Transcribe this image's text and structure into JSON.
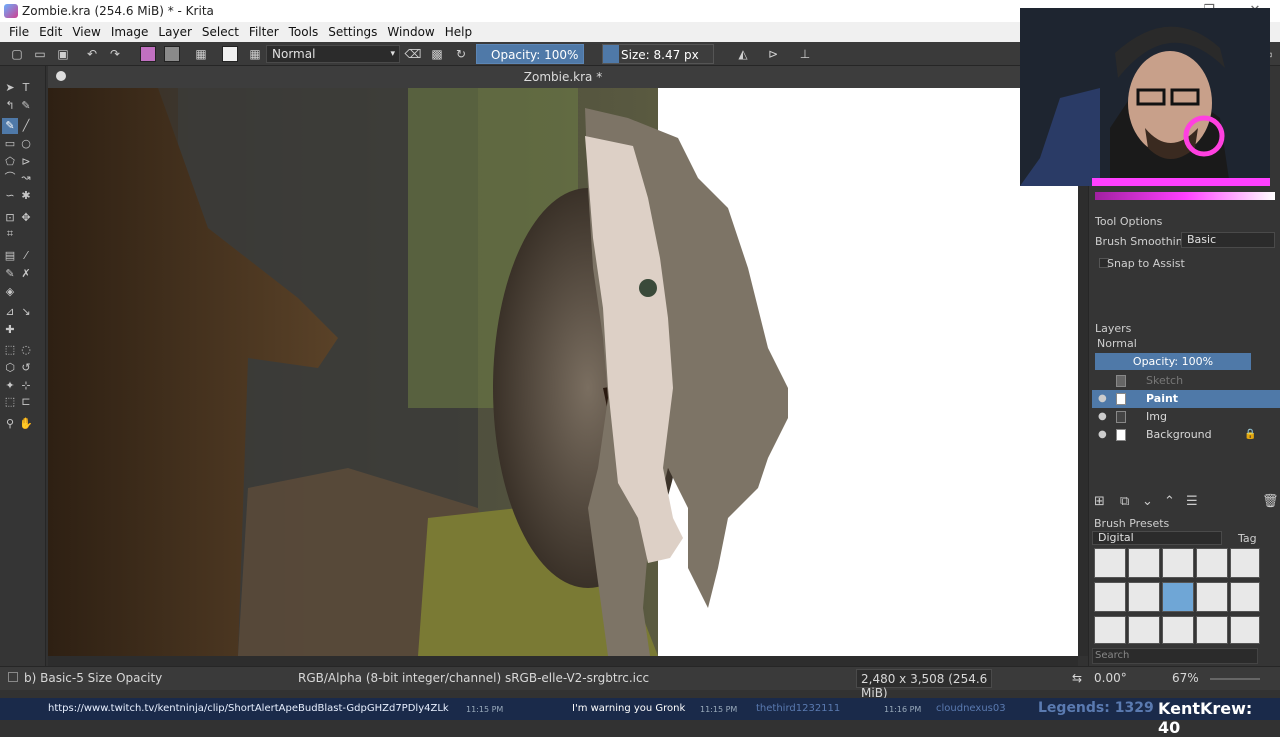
{
  "window": {
    "title": "Zombie.kra (254.6 MiB)  * - Krita",
    "minimize": "—",
    "maximize": "❐",
    "close": "✕"
  },
  "menu": [
    "File",
    "Edit",
    "View",
    "Image",
    "Layer",
    "Select",
    "Filter",
    "Tools",
    "Settings",
    "Window",
    "Help"
  ],
  "toolbar": {
    "blend_mode": "Normal",
    "opacity_label": "Opacity: 100%",
    "size_label": "Size: 8.47 px",
    "fg_color": "#c070c0",
    "bg_color": "#8a8a8a"
  },
  "document": {
    "tab_title": "Zombie.kra *"
  },
  "docker": {
    "tool_options_title": "Tool Options",
    "brush_smoothing_label": "Brush Smoothing",
    "brush_smoothing_value": "Basic",
    "snap_label": "Snap to Assist",
    "layers_title": "Layers",
    "layers_blend": "Normal",
    "layers_opacity": "Opacity:  100%",
    "layers": [
      {
        "name": "Sketch",
        "visible": false,
        "locked": false
      },
      {
        "name": "Paint",
        "visible": true,
        "locked": false,
        "active": true
      },
      {
        "name": "Img",
        "visible": true,
        "locked": false
      },
      {
        "name": "Background",
        "visible": true,
        "locked": true
      }
    ],
    "brush_presets_title": "Brush Presets",
    "preset_tag": "Digital",
    "tag_label": "Tag",
    "search_placeholder": "Search"
  },
  "statusbar": {
    "brush": "b) Basic-5 Size Opacity",
    "color_profile": "RGB/Alpha (8-bit integer/channel)  sRGB-elle-V2-srgbtrc.icc",
    "dimensions": "2,480 x 3,508 (254.6 MiB)",
    "rotation": "0.00°",
    "zoom": "67%"
  },
  "streambar": {
    "clip_url": "https://www.twitch.tv/kentninja/clip/ShortAlertApeBudBlast-GdpGHZd7PDly4ZLk",
    "time1": "11:15 PM",
    "message": "I'm warning you Gronk",
    "time2": "11:15 PM",
    "user2": "thethird1232111",
    "time3": "11:16 PM",
    "user3": "cloudnexus03",
    "legends": "Legends: 1329",
    "krew": "KentKrew: 40"
  },
  "colors": {
    "accent": "#4f79a8",
    "hair": "#7d7466",
    "skin": "#ddd0c6",
    "eye": "#3a4a3a"
  }
}
